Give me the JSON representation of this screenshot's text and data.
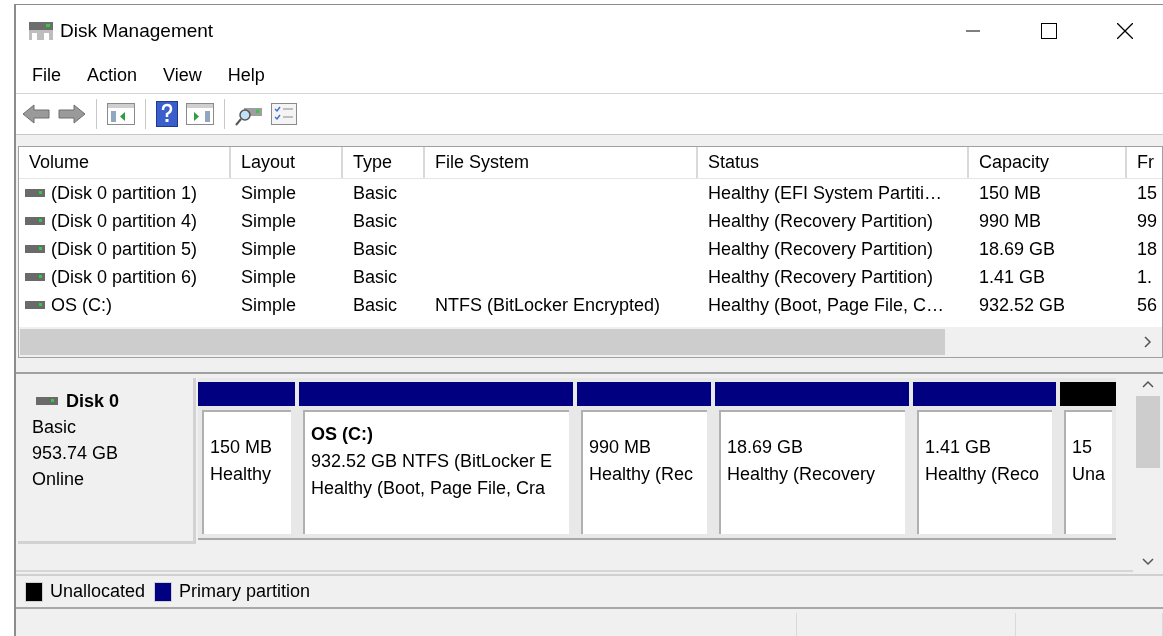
{
  "window": {
    "title": "Disk Management"
  },
  "menu": [
    "File",
    "Action",
    "View",
    "Help"
  ],
  "table": {
    "columns": [
      "Volume",
      "Layout",
      "Type",
      "File System",
      "Status",
      "Capacity",
      "Fr"
    ],
    "rows": [
      {
        "volume": "(Disk 0 partition 1)",
        "layout": "Simple",
        "type": "Basic",
        "status": "Healthy (EFI System Partiti…",
        "capacity": "150 MB",
        "column_7": "15"
      },
      {
        "volume": "(Disk 0 partition 4)",
        "layout": "Simple",
        "type": "Basic",
        "status": "Healthy (Recovery Partition)",
        "capacity": "990 MB",
        "column_7": "99"
      },
      {
        "volume": "(Disk 0 partition 5)",
        "layout": "Simple",
        "type": "Basic",
        "status": "Healthy (Recovery Partition)",
        "capacity": "18.69 GB",
        "column_7": "18"
      },
      {
        "volume": "(Disk 0 partition 6)",
        "layout": "Simple",
        "type": "Basic",
        "status": "Healthy (Recovery Partition)",
        "capacity": "1.41 GB",
        "column_7": "1."
      },
      {
        "volume": "OS (C:)",
        "layout": "Simple",
        "type": "Basic",
        "file_system": "NTFS (BitLocker Encrypted)",
        "status": "Healthy (Boot, Page File, C…",
        "capacity": "932.52 GB",
        "column_7": "56"
      }
    ]
  },
  "disk": {
    "name": "Disk 0",
    "type": "Basic",
    "size": "953.74 GB",
    "status": "Online",
    "partitions": [
      {
        "kind": "primary",
        "lines": [
          "150 MB",
          "Healthy"
        ]
      },
      {
        "kind": "primary",
        "title": "OS  (C:)",
        "lines": [
          "932.52 GB NTFS (BitLocker E",
          "Healthy (Boot, Page File, Cra"
        ]
      },
      {
        "kind": "primary",
        "lines": [
          "990 MB",
          "Healthy (Rec"
        ]
      },
      {
        "kind": "primary",
        "lines": [
          "18.69 GB",
          "Healthy (Recovery"
        ]
      },
      {
        "kind": "primary",
        "lines": [
          "1.41 GB",
          "Healthy (Reco"
        ]
      },
      {
        "kind": "unallocated",
        "lines": [
          "15",
          "Una"
        ]
      }
    ]
  },
  "legend": [
    {
      "kind": "unallocated",
      "label": "Unallocated",
      "color": "#000000"
    },
    {
      "kind": "primary",
      "label": "Primary partition",
      "color": "#000080"
    }
  ]
}
